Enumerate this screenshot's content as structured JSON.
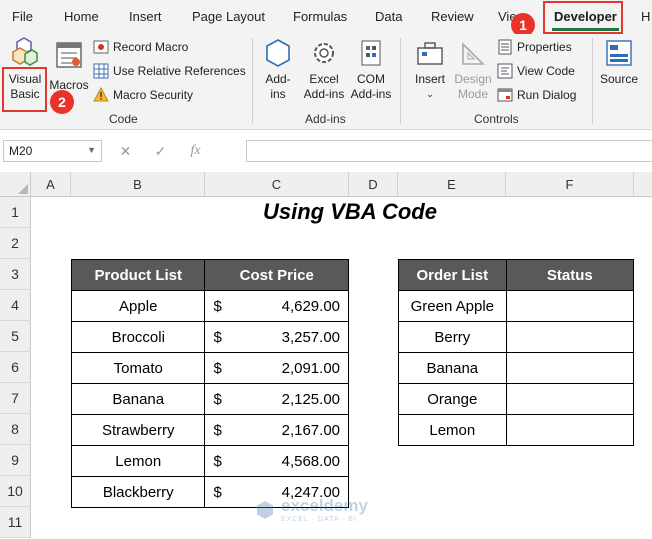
{
  "tabs": [
    "File",
    "Home",
    "Insert",
    "Page Layout",
    "Formulas",
    "Data",
    "Review",
    "Vie",
    "Developer",
    "H"
  ],
  "active_tab": "Developer",
  "badges": [
    "1",
    "2"
  ],
  "ribbon": {
    "code": {
      "visual_basic": [
        "Visual",
        "Basic"
      ],
      "macros": "Macros",
      "record_macro": "Record Macro",
      "relative_refs": "Use Relative References",
      "macro_security": "Macro Security",
      "label": "Code"
    },
    "addins": {
      "addins": [
        "Add-",
        "ins"
      ],
      "excel_addins": [
        "Excel",
        "Add-ins"
      ],
      "com_addins": [
        "COM",
        "Add-ins"
      ],
      "label": "Add-ins"
    },
    "controls": {
      "insert": "Insert",
      "design_mode": [
        "Design",
        "Mode"
      ],
      "properties": "Properties",
      "view_code": "View Code",
      "run_dialog": "Run Dialog",
      "label": "Controls"
    },
    "source": "Source"
  },
  "formula_bar": {
    "name_box": "M20",
    "fx": "fx",
    "formula": ""
  },
  "columns": [
    "A",
    "B",
    "C",
    "D",
    "E",
    "F",
    "G"
  ],
  "rows": [
    "1",
    "2",
    "3",
    "4",
    "5",
    "6",
    "7",
    "8",
    "9",
    "10",
    "11"
  ],
  "sheet": {
    "title": "Using VBA Code",
    "product_table": {
      "headers": [
        "Product List",
        "Cost Price"
      ],
      "currency": "$",
      "rows": [
        {
          "name": "Apple",
          "price": "4,629.00"
        },
        {
          "name": "Broccoli",
          "price": "3,257.00"
        },
        {
          "name": "Tomato",
          "price": "2,091.00"
        },
        {
          "name": "Banana",
          "price": "2,125.00"
        },
        {
          "name": "Strawberry",
          "price": "2,167.00"
        },
        {
          "name": "Lemon",
          "price": "4,568.00"
        },
        {
          "name": "Blackberry",
          "price": "4,247.00"
        }
      ]
    },
    "order_table": {
      "headers": [
        "Order List",
        "Status"
      ],
      "rows": [
        {
          "name": "Green Apple",
          "status": ""
        },
        {
          "name": "Berry",
          "status": ""
        },
        {
          "name": "Banana",
          "status": ""
        },
        {
          "name": "Orange",
          "status": ""
        },
        {
          "name": "Lemon",
          "status": ""
        }
      ]
    }
  },
  "watermark": {
    "name": "exceldemy",
    "tagline": "EXCEL · DATA · BI"
  },
  "colors": {
    "accent": "#217346",
    "header_fill": "#595959",
    "highlight": "#e03a2f"
  }
}
